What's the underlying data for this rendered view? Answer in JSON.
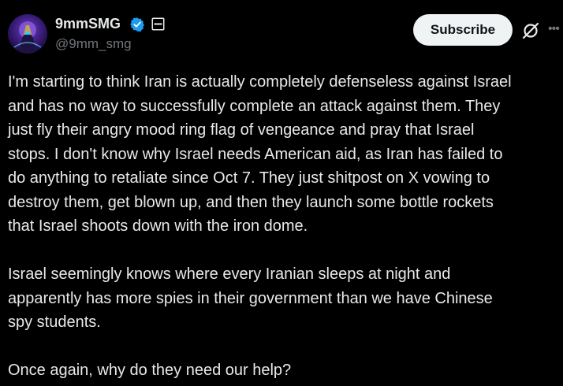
{
  "author": {
    "display_name": "9mmSMG",
    "handle": "@9mm_smg",
    "verified": true,
    "badge_color": "#1d9bf0"
  },
  "actions": {
    "subscribe_label": "Subscribe",
    "grok_icon": "grok-slash-circle-icon",
    "more_icon": "more-dots-icon"
  },
  "post": {
    "paragraphs": [
      [
        "I'm starting to think Iran is actually completely defenseless against Israel",
        "and has no way to successfully complete an attack against them. They",
        "just fly their angry mood ring flag of vengeance and pray that Israel",
        "stops. I don't know why Israel needs American aid, as Iran has failed to",
        "do anything to retaliate since Oct 7. They just shitpost on X vowing to",
        "destroy them, get blown up, and then they launch some bottle rockets",
        "that Israel shoots down with the iron dome."
      ],
      [
        "Israel seemingly knows where every Iranian sleeps at night and",
        "apparently has more spies in their government than we have Chinese",
        "spy students."
      ],
      [
        "Once again, why do they need our help?"
      ]
    ]
  },
  "colors": {
    "background": "#000000",
    "text": "#e7e9ea",
    "secondary_text": "#71767b",
    "button_bg": "#eff3f4"
  }
}
